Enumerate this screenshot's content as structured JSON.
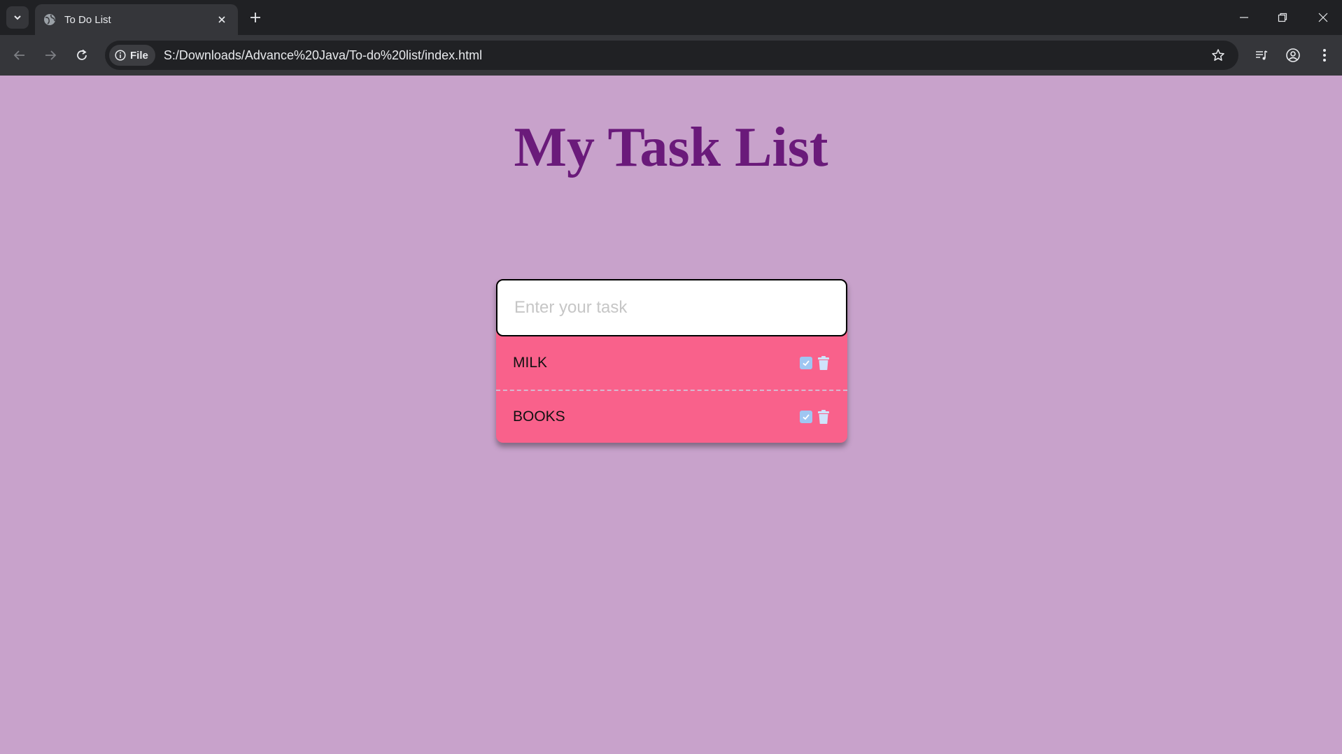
{
  "browser": {
    "tab_title": "To Do List",
    "info_chip_label": "File",
    "url": "S:/Downloads/Advance%20Java/To-do%20list/index.html"
  },
  "page": {
    "heading": "My Task List",
    "input_placeholder": "Enter your task",
    "input_value": "",
    "tasks": [
      {
        "text": "MILK",
        "completed": false
      },
      {
        "text": "BOOKS",
        "completed": false
      }
    ]
  },
  "colors": {
    "page_background": "#c8a2cb",
    "heading": "#6a1a7a",
    "task_item_background": "#f9618b",
    "check_button": "#9fc6f2"
  }
}
